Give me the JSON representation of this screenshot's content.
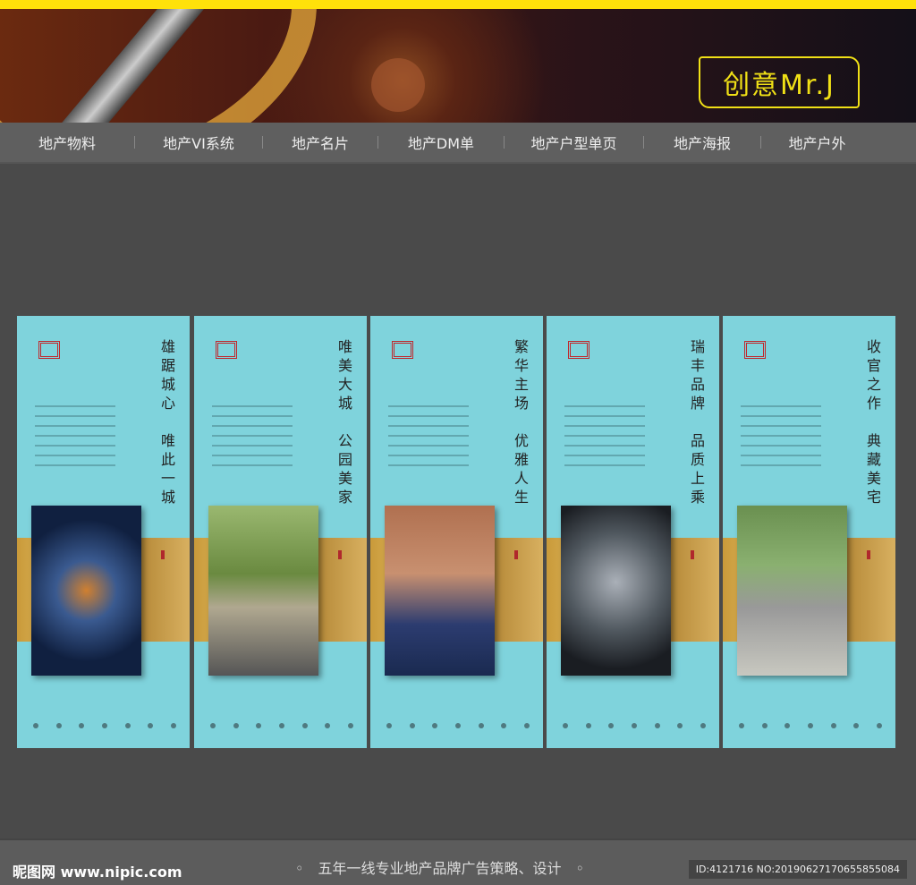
{
  "header": {
    "logo_text": "创意Mr.J"
  },
  "nav": [
    "地产物料",
    "地产VI系统",
    "地产名片",
    "地产DM单",
    "地产户型单页",
    "地产海报",
    "地产户外"
  ],
  "panels": [
    {
      "title": "雄踞城心　唯此一城",
      "photo": "highway-interchange"
    },
    {
      "title": "唯美大城　公园美家",
      "photo": "couple-cycling"
    },
    {
      "title": "繁华主场　优雅人生",
      "photo": "schoolchildren"
    },
    {
      "title": "瑞丰品牌　品质上乘",
      "photo": "clock-leopard"
    },
    {
      "title": "收官之作　典藏美宅",
      "photo": "elderly-family"
    }
  ],
  "footer": {
    "site": "昵图网 www.nipic.com",
    "slogan": "◦　五年一线专业地产品牌广告策略、设计　◦",
    "id": "ID:4121716 NO:20190627170655855084"
  },
  "colors": {
    "accent": "#ffe10a",
    "panel": "#7fd3dc",
    "gold": "#c99a3a"
  }
}
